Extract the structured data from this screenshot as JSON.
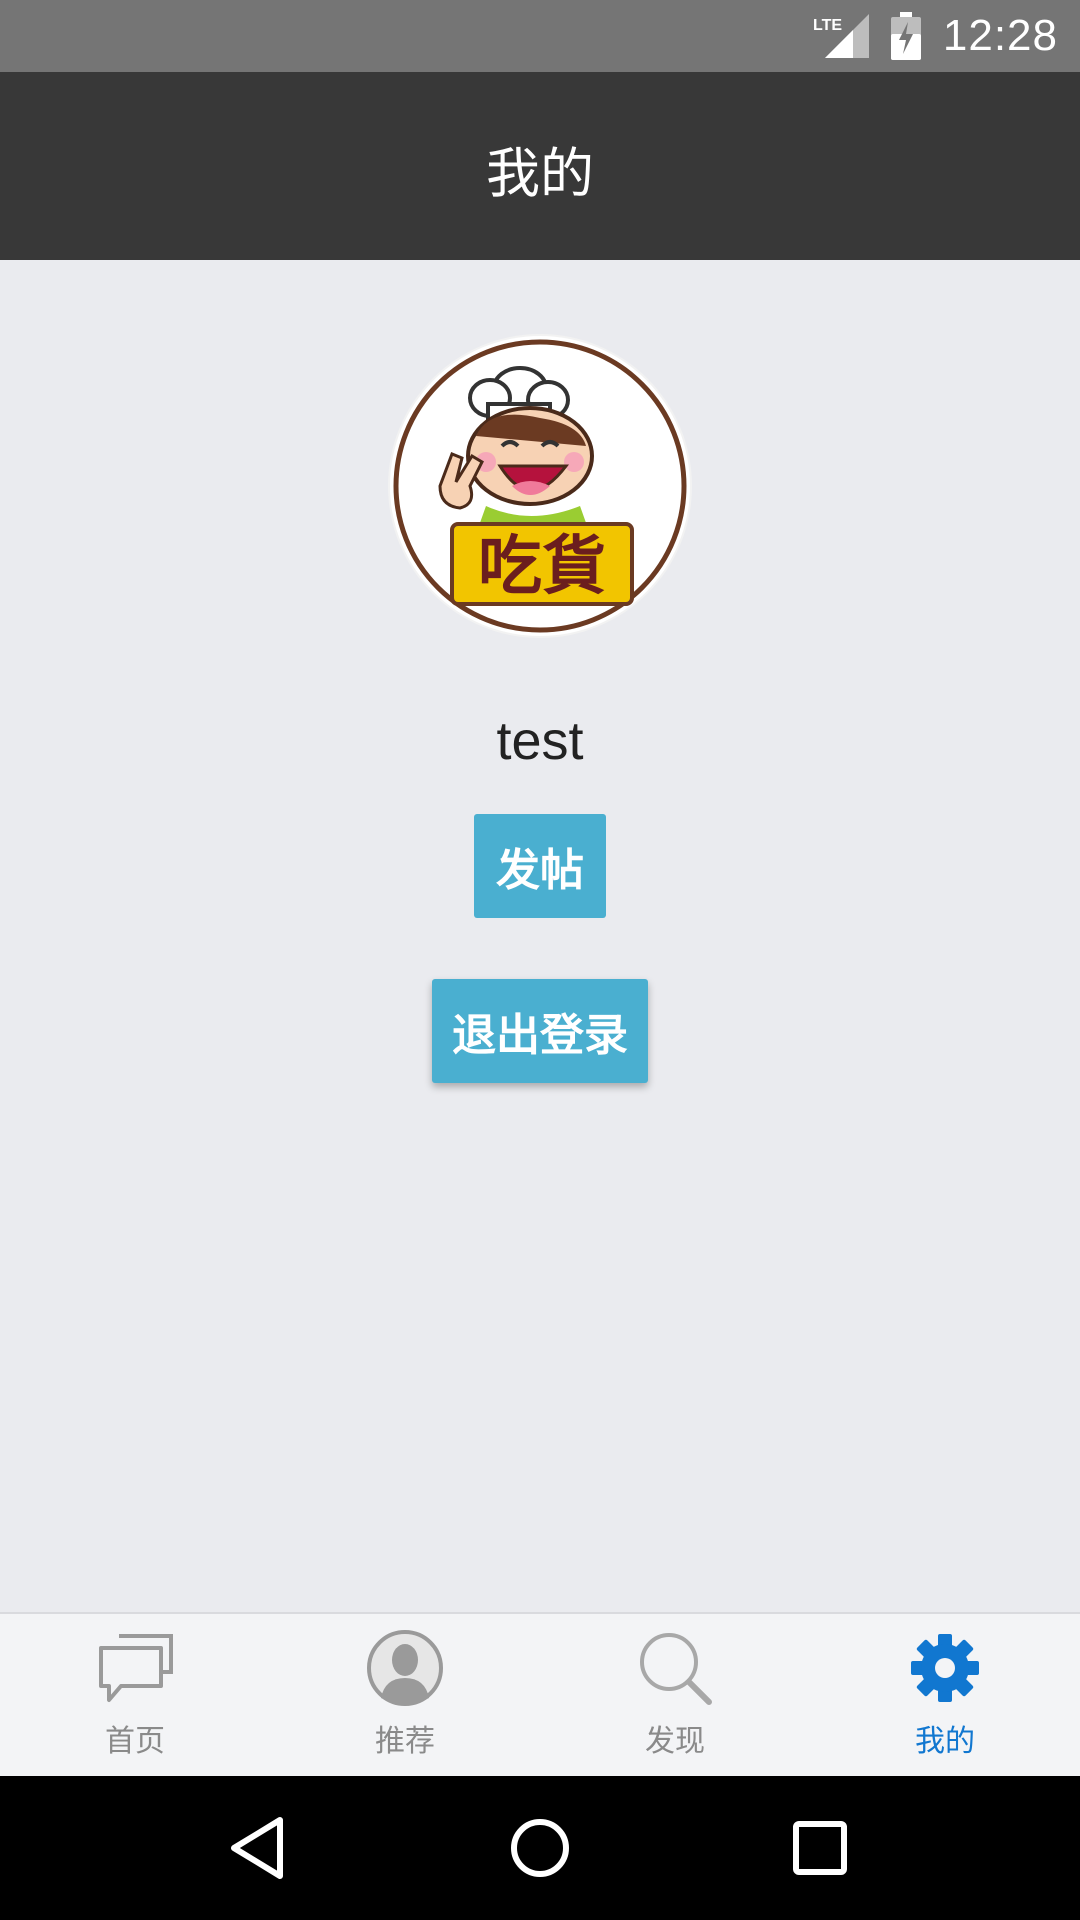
{
  "status_bar": {
    "network": "LTE",
    "time": "12:28"
  },
  "app_bar": {
    "title": "我的"
  },
  "profile": {
    "avatar_label": "吃貨",
    "username": "test"
  },
  "actions": {
    "post_label": "发帖",
    "logout_label": "退出登录"
  },
  "bottom_nav": {
    "items": [
      {
        "label": "首页",
        "icon": "chat-bubbles-icon",
        "active": false
      },
      {
        "label": "推荐",
        "icon": "person-icon",
        "active": false
      },
      {
        "label": "发现",
        "icon": "search-icon",
        "active": false
      },
      {
        "label": "我的",
        "icon": "gear-icon",
        "active": true
      }
    ]
  },
  "colors": {
    "accent": "#4aafd0",
    "active_tab": "#1177d0",
    "app_bar": "#383838"
  }
}
